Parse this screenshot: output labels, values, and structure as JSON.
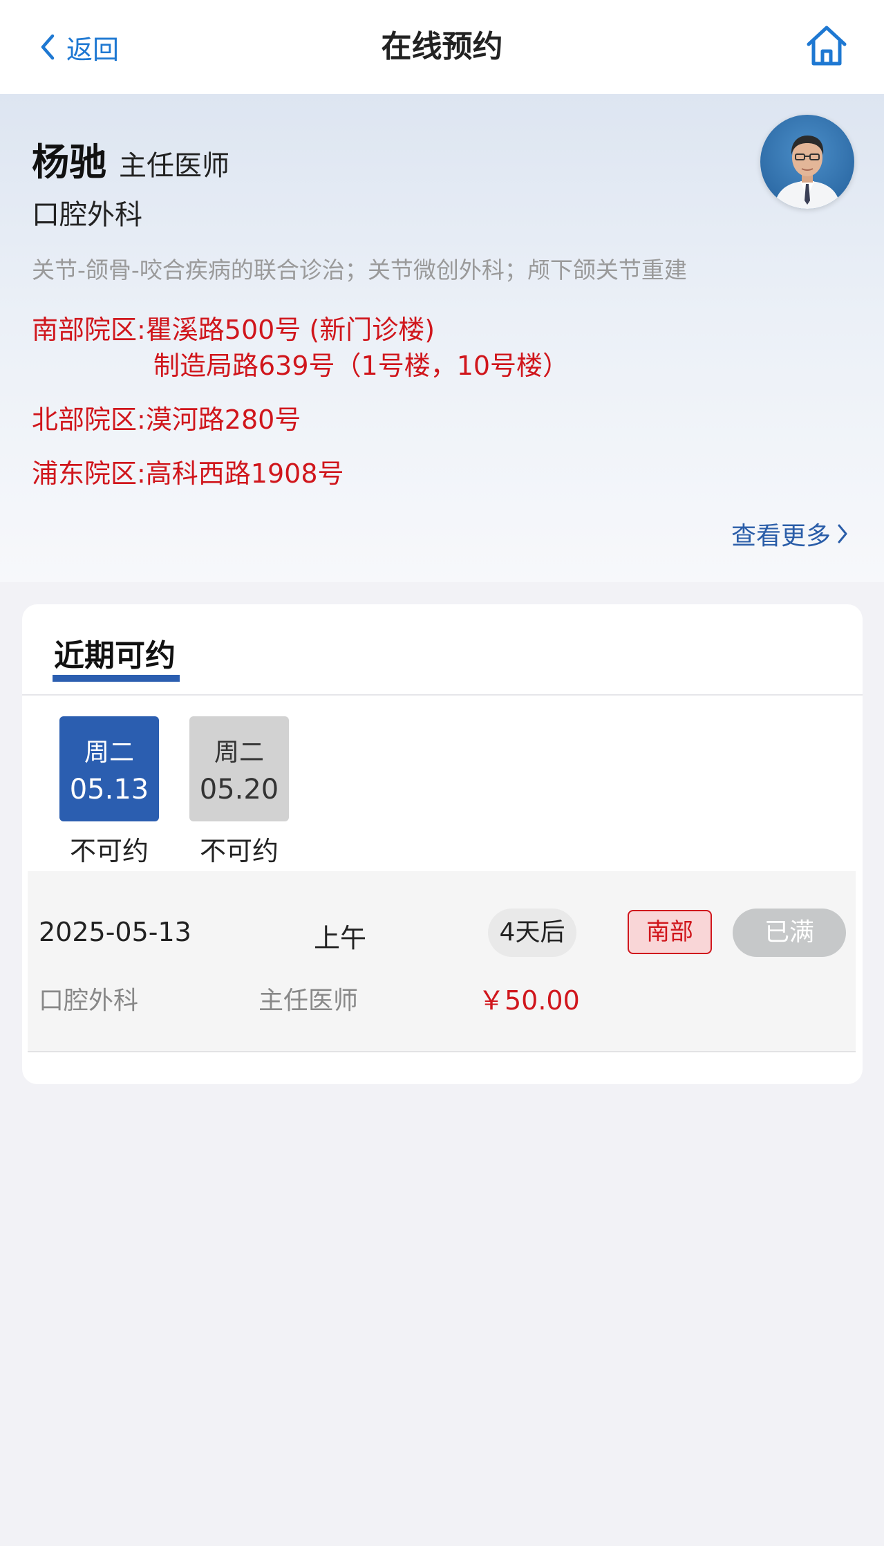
{
  "header": {
    "back_label": "返回",
    "title": "在线预约",
    "icons": {
      "back": "chevron-left-icon",
      "home": "home-icon"
    },
    "accent_color": "#1e78d2"
  },
  "doctor": {
    "name": "杨驰",
    "title": "主任医师",
    "department": "口腔外科",
    "specialty": "关节-颌骨-咬合疾病的联合诊治；关节微创外科；颅下颌关节重建",
    "addresses": [
      {
        "line": "南部院区:瞿溪路500号 (新门诊楼)"
      },
      {
        "line": "制造局路639号（1号楼，10号楼）"
      },
      {
        "line": "北部院区:漠河路280号"
      },
      {
        "line": "浦东院区:高科西路1908号"
      }
    ],
    "address_color": "#d0161c",
    "more_label": "查看更多"
  },
  "schedule": {
    "tab_label": "近期可约",
    "dates": [
      {
        "weekday": "周二",
        "date": "05.13",
        "status": "不可约",
        "selected": true
      },
      {
        "weekday": "周二",
        "date": "05.20",
        "status": "不可约",
        "selected": false
      }
    ],
    "slot": {
      "date": "2025-05-13",
      "period": "上午",
      "days_until": "4天后",
      "campus": "南部",
      "availability": "已满",
      "department": "口腔外科",
      "rank": "主任医师",
      "fee": "￥50.00"
    },
    "primary_color": "#2b5eb0"
  }
}
